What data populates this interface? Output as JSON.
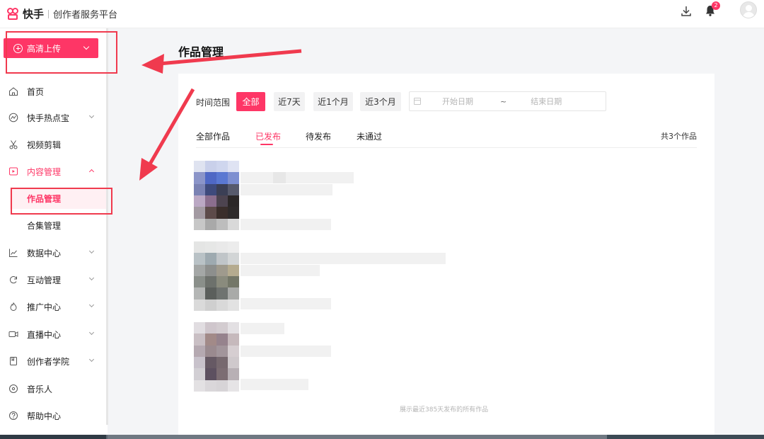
{
  "header": {
    "brand": "快手",
    "subtitle": "创作者服务平台",
    "notification_count": "2"
  },
  "sidebar": {
    "upload_label": "高清上传",
    "items": [
      {
        "label": "首页",
        "icon": "home-icon"
      },
      {
        "label": "快手热点宝",
        "icon": "hotspot-icon"
      },
      {
        "label": "视频剪辑",
        "icon": "scissors-icon"
      },
      {
        "label": "内容管理",
        "icon": "play-box-icon"
      },
      {
        "label": "作品管理"
      },
      {
        "label": "合集管理"
      },
      {
        "label": "数据中心",
        "icon": "chart-line-icon"
      },
      {
        "label": "互动管理",
        "icon": "refresh-icon"
      },
      {
        "label": "推广中心",
        "icon": "flame-icon"
      },
      {
        "label": "直播中心",
        "icon": "video-camera-icon"
      },
      {
        "label": "创作者学院",
        "icon": "book-icon"
      },
      {
        "label": "音乐人",
        "icon": "music-disc-icon"
      },
      {
        "label": "帮助中心",
        "icon": "help-icon"
      }
    ]
  },
  "main": {
    "title": "作品管理",
    "filter": {
      "label": "时间范围",
      "chips": [
        "全部",
        "近7天",
        "近1个月",
        "近3个月"
      ],
      "start_placeholder": "开始日期",
      "separator": "~",
      "end_placeholder": "结束日期"
    },
    "tabs": [
      "全部作品",
      "已发布",
      "待发布",
      "未通过"
    ],
    "total": "共3个作品",
    "footer_note": "展示最近385天发布的所有作品"
  },
  "colors": {
    "accent": "#fe3666",
    "annotation": "#f03a4e"
  }
}
